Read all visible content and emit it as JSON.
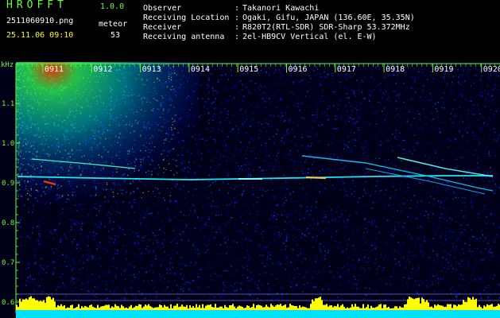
{
  "header": {
    "app_title": "HROFFT",
    "app_version": "1.0.0",
    "filename": "2511060910.png",
    "datetime": "25.11.06 09:10",
    "meteor_label": "meteor",
    "meteor_count": "53",
    "info": [
      {
        "label": "Observer",
        "value": "Takanori Kawachi"
      },
      {
        "label": "Receiving Location",
        "value": "Ogaki, Gifu, JAPAN (136.60E, 35.35N)"
      },
      {
        "label": "Receiver",
        "value": "R820T2(RTL-SDR) SDR-Sharp 53.372MHz"
      },
      {
        "label": "Receiving antenna",
        "value": "2el-HB9CV Vertical (el. E-W)"
      }
    ]
  },
  "spectrogram": {
    "y_unit": "kHz",
    "y_ticks": [
      "1.1",
      "1.0",
      "0.9",
      "0.8",
      "0.7",
      "0.6"
    ],
    "x_ticks": [
      "0911",
      "0912",
      "0913",
      "0914",
      "0915",
      "0916",
      "0917",
      "0918",
      "0919",
      "0920"
    ]
  }
}
